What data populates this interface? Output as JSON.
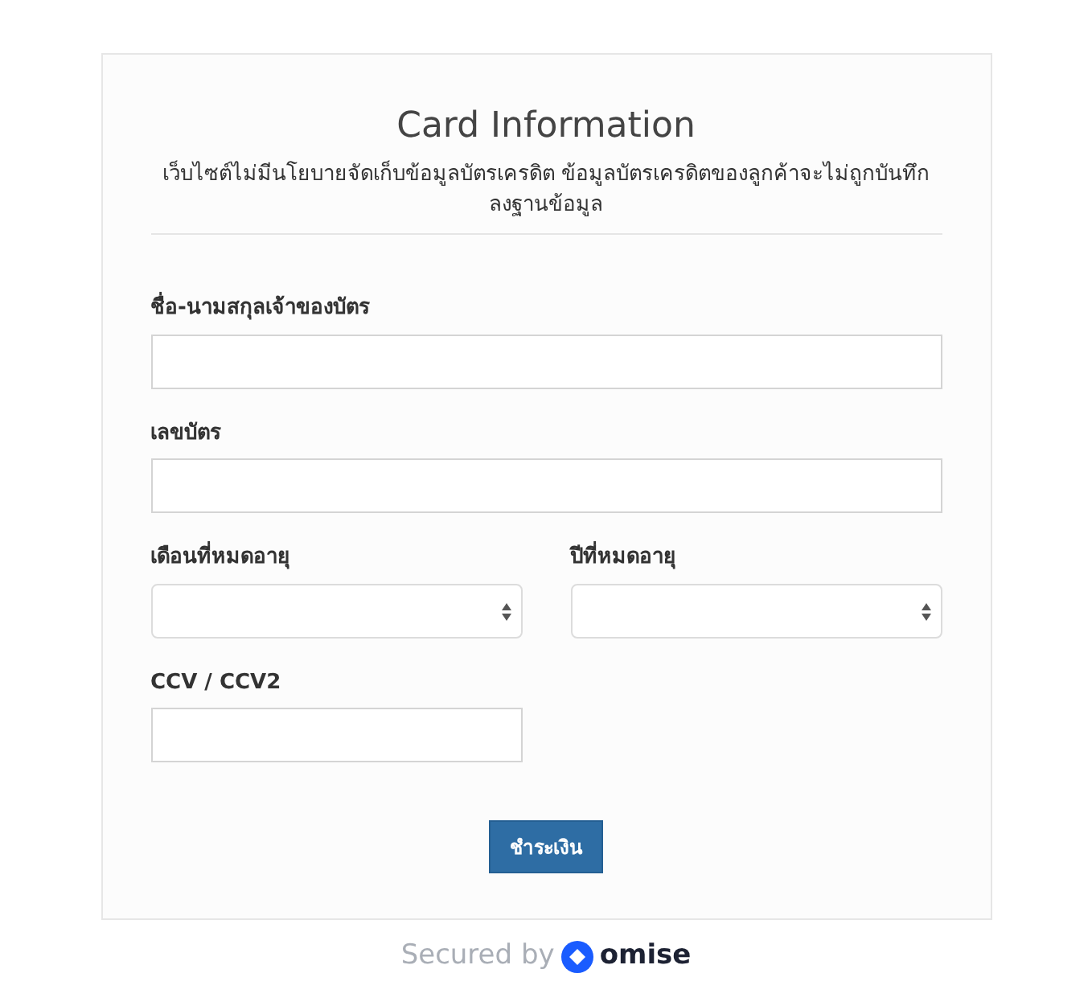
{
  "title": "Card Information",
  "notice": "เว็บไซต์ไม่มีนโยบายจัดเก็บข้อมูลบัตรเครดิต ข้อมูลบัตรเครดิตของลูกค้าจะไม่ถูกบันทึกลงฐานข้อมูล",
  "fields": [
    {
      "label": "ชื่อ-นามสกุลเจ้าของบัตร",
      "kind": "text"
    },
    {
      "label": "เลขบัตร",
      "kind": "text"
    },
    {
      "label": "เดือนที่หมดอายุ",
      "kind": "select"
    },
    {
      "label": "ปีที่หมดอายุ",
      "kind": "select"
    },
    {
      "label": "CCV / CCV2",
      "kind": "short"
    }
  ],
  "submit_button": "ชำระเงิน",
  "footer": {
    "secured_by": "Secured by",
    "brand": "omise"
  }
}
